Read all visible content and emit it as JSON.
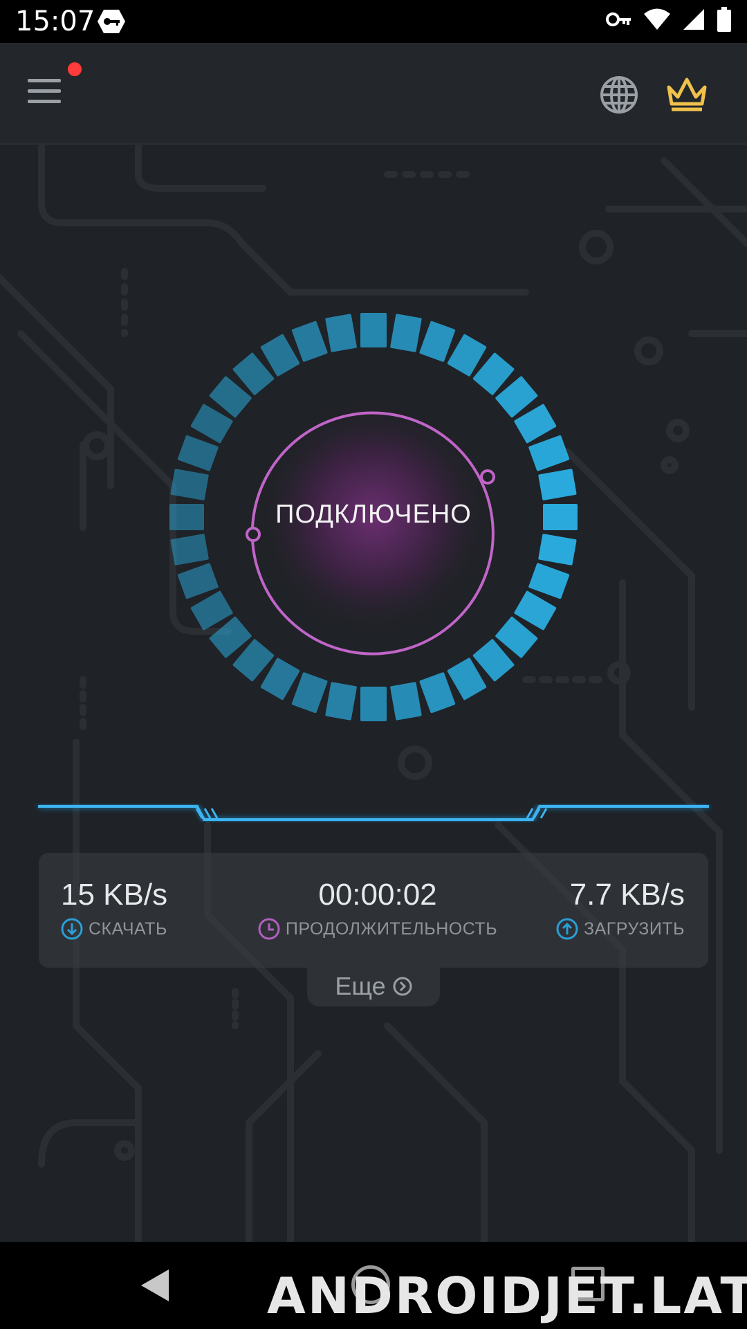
{
  "status_bar": {
    "time": "15:07",
    "icons": [
      "vpn-key-badge-icon",
      "key-icon",
      "wifi-icon",
      "cell-signal-icon",
      "battery-icon"
    ]
  },
  "header": {
    "menu_icon": "hamburger-menu-icon",
    "has_notification_dot": true,
    "notification_color": "#ff3b3b",
    "right_icons": [
      "globe-icon",
      "crown-icon"
    ],
    "crown_color": "#f0c14b"
  },
  "connection": {
    "status": "ПОДКЛЮЧЕНО",
    "ring_color": "#2aa9dc",
    "arc_color": "#c065c8"
  },
  "stats": {
    "download": {
      "value": "15 KB/s",
      "label": "СКАЧАТЬ",
      "icon": "download-arrow-icon"
    },
    "duration": {
      "value": "00:00:02",
      "label": "ПРОДОЛЖИТЕЛЬНОСТЬ",
      "icon": "clock-icon"
    },
    "upload": {
      "value": "7.7 KB/s",
      "label": "ЗАГРУЗИТЬ",
      "icon": "upload-arrow-icon"
    }
  },
  "more": {
    "label": "Еще",
    "icon": "chevron-circle-right-icon"
  },
  "nav_bar": {
    "buttons": [
      "back-icon",
      "home-icon",
      "recents-icon"
    ]
  },
  "watermark": "ANDROIDJET.LAT"
}
